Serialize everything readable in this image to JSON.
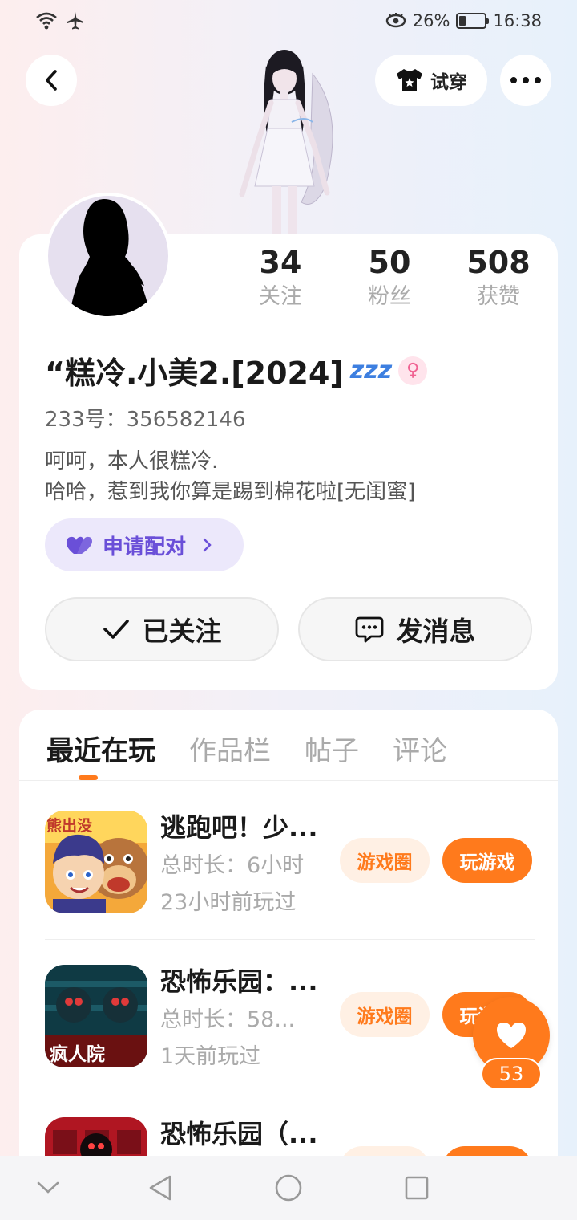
{
  "status_bar": {
    "battery_percent": "26%",
    "battery_level": 0.26,
    "time": "16:38"
  },
  "header": {
    "tryon_label": "试穿"
  },
  "profile": {
    "stats": [
      {
        "value": "34",
        "label": "关注"
      },
      {
        "value": "50",
        "label": "粉丝"
      },
      {
        "value": "508",
        "label": "获赞"
      }
    ],
    "nickname": "“糕冷.小美2.[2024]",
    "status_emoji": "zzz",
    "gender_icon": "female-icon",
    "uid": "233号：356582146",
    "bio_line1": "呵呵，本人很糕冷.",
    "bio_line2": "哈哈，惹到我你算是踢到棉花啦[无闺蜜]",
    "pair_label": "申请配对",
    "follow_label": "已关注",
    "message_label": "发消息"
  },
  "tabs": [
    {
      "label": "最近在玩",
      "active": true
    },
    {
      "label": "作品栏",
      "active": false
    },
    {
      "label": "帖子",
      "active": false
    },
    {
      "label": "评论",
      "active": false
    }
  ],
  "games": [
    {
      "title": "逃跑吧！少...",
      "duration": "总时长：6小时",
      "last_played": "23小时前玩过",
      "circle_label": "游戏圈",
      "play_label": "玩游戏",
      "icon_text": "熊出没"
    },
    {
      "title": "恐怖乐园：...",
      "duration": "总时长：58...",
      "last_played": "1天前玩过",
      "circle_label": "游戏圈",
      "play_label": "玩游戏",
      "icon_text": "疯人院"
    },
    {
      "title": "恐怖乐园（...",
      "duration": "",
      "last_played": "",
      "circle_label": "",
      "play_label": "",
      "icon_text": ""
    }
  ],
  "like_float": {
    "count": "53"
  },
  "colors": {
    "accent": "#ff7a1c",
    "pair": "#6a4fd8",
    "pair_bg": "#ece8fb"
  }
}
